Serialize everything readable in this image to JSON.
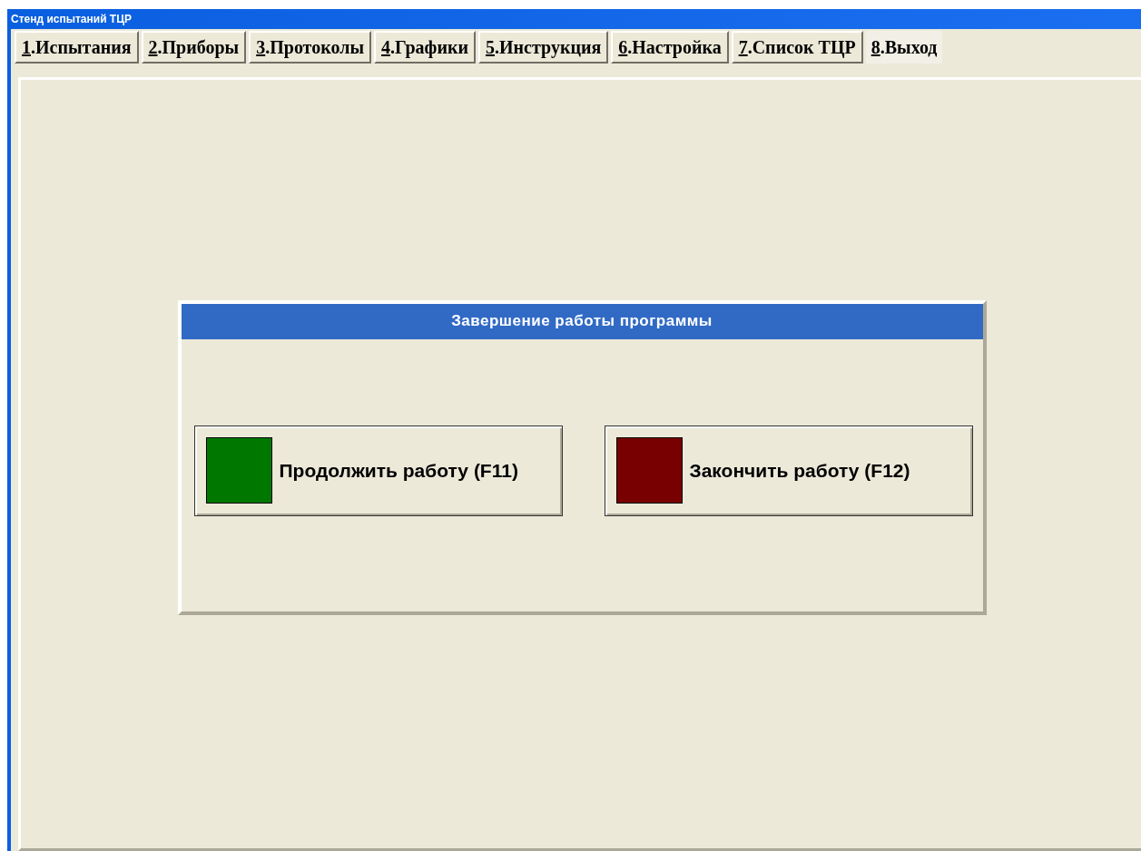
{
  "window": {
    "title": "Стенд испытаний ТЦР"
  },
  "tabs": [
    {
      "label": "1.Испытания",
      "selected": false
    },
    {
      "label": "2.Приборы",
      "selected": false
    },
    {
      "label": "3.Протоколы",
      "selected": false
    },
    {
      "label": "4.Графики",
      "selected": false
    },
    {
      "label": "5.Инструкция",
      "selected": false
    },
    {
      "label": "6.Настройка",
      "selected": false
    },
    {
      "label": "7.Список ТЦР",
      "selected": false
    },
    {
      "label": "8.Выход",
      "selected": true
    }
  ],
  "dialog": {
    "title": "Завершение работы программы",
    "buttons": [
      {
        "label": "Продолжить работу (F11)",
        "color": "#007800"
      },
      {
        "label": "Закончить работу (F12)",
        "color": "#780000"
      }
    ]
  }
}
